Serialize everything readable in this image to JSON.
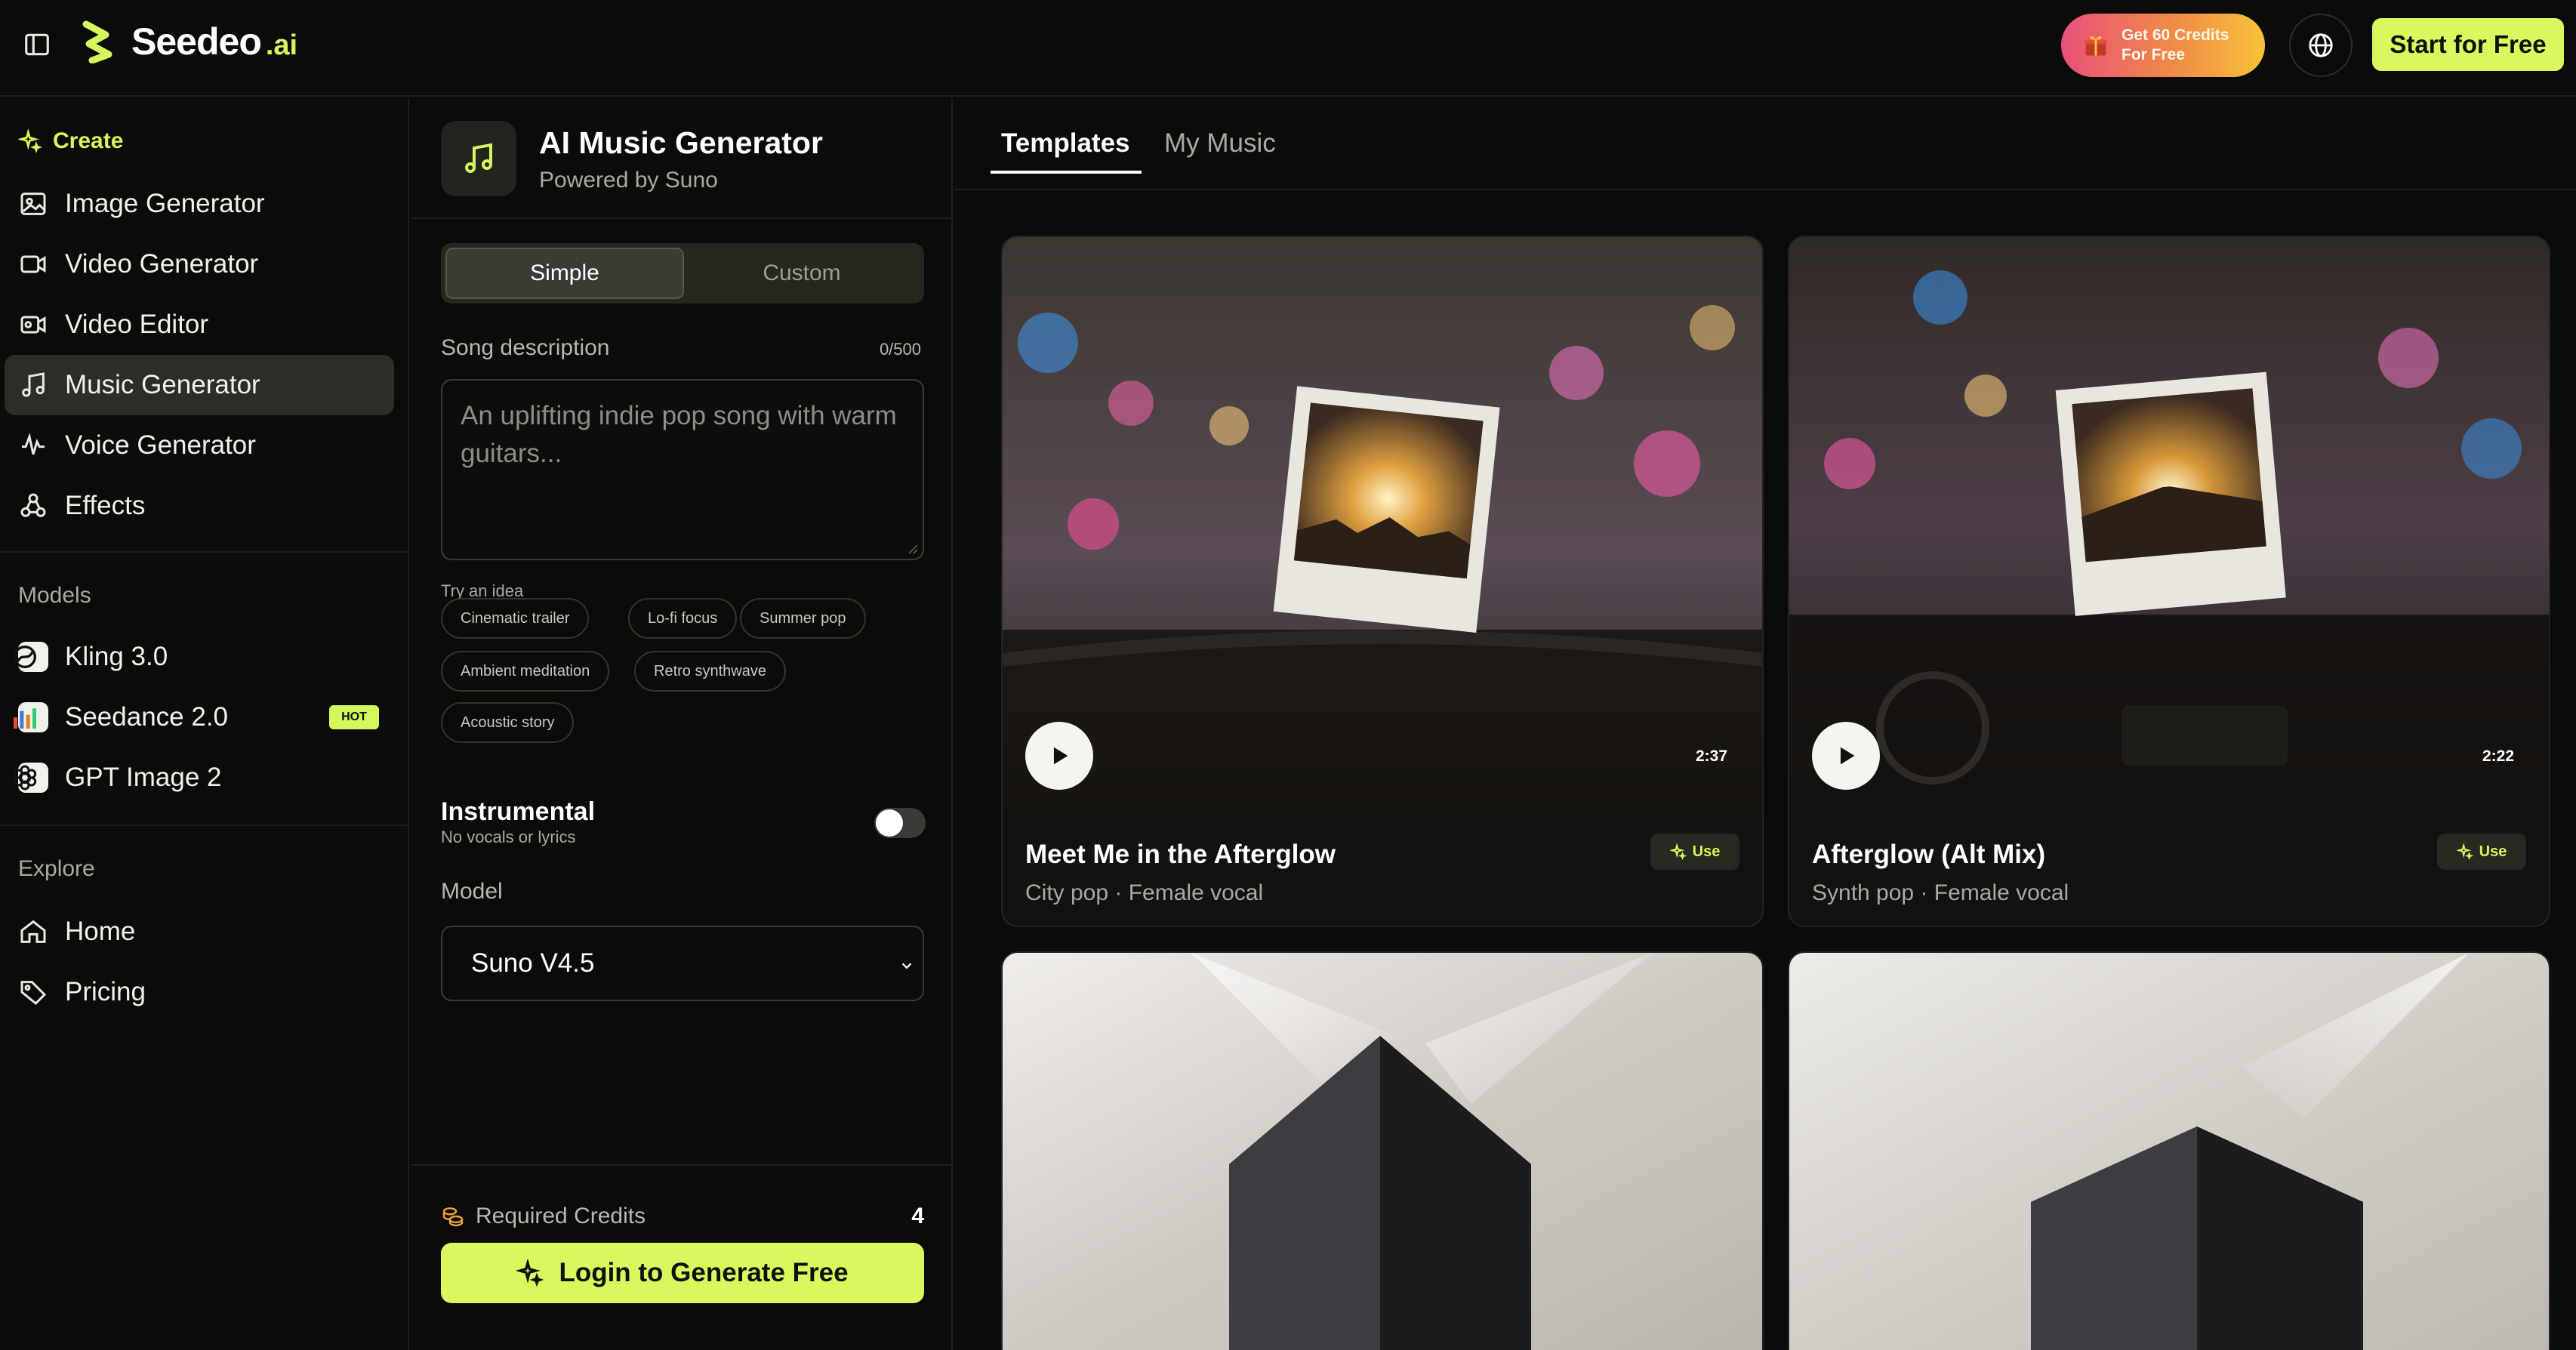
{
  "brand": {
    "name": "Seedeo",
    "tld": ".ai",
    "accent": "#d9f85e"
  },
  "topbar": {
    "credits_line1": "Get 60 Credits",
    "credits_line2": "For Free",
    "start_label": "Start for Free"
  },
  "sidebar": {
    "create_label": "Create",
    "create_items": [
      {
        "label": "Image Generator",
        "icon": "image-icon"
      },
      {
        "label": "Video Generator",
        "icon": "video-icon"
      },
      {
        "label": "Video Editor",
        "icon": "video-editor-icon"
      },
      {
        "label": "Music Generator",
        "icon": "music-note-icon",
        "active": true
      },
      {
        "label": "Voice Generator",
        "icon": "waveform-icon"
      },
      {
        "label": "Effects",
        "icon": "effects-icon"
      }
    ],
    "models_label": "Models",
    "models": [
      {
        "label": "Kling 3.0",
        "icon": "kling-logo-icon"
      },
      {
        "label": "Seedance 2.0",
        "icon": "seedance-logo-icon",
        "badge": "HOT"
      },
      {
        "label": "GPT Image 2",
        "icon": "openai-logo-icon"
      }
    ],
    "explore_label": "Explore",
    "explore": [
      {
        "label": "Home",
        "icon": "home-icon"
      },
      {
        "label": "Pricing",
        "icon": "tag-icon"
      }
    ]
  },
  "form": {
    "title": "AI Music Generator",
    "subtitle": "Powered by Suno",
    "mode_simple": "Simple",
    "mode_custom": "Custom",
    "desc_label": "Song description",
    "desc_counter": "0/500",
    "desc_placeholder": "An uplifting indie pop song with warm guitars...",
    "try_label": "Try an idea",
    "ideas": [
      "Cinematic trailer",
      "Lo-fi focus",
      "Summer pop",
      "Ambient meditation",
      "Retro synthwave",
      "Acoustic story"
    ],
    "instrumental_label": "Instrumental",
    "instrumental_sub": "No vocals or lyrics",
    "instrumental_on": false,
    "model_label": "Model",
    "model_value": "Suno V4.5",
    "required_credits_label": "Required Credits",
    "required_credits": "4",
    "login_label": "Login to Generate Free"
  },
  "content": {
    "tabs": [
      "Templates",
      "My Music"
    ],
    "active_tab": "Templates",
    "cards": [
      {
        "title": "Meet Me in the Afterglow",
        "subtitle": "City pop · Female vocal",
        "duration": "2:37",
        "use": "Use"
      },
      {
        "title": "Afterglow (Alt Mix)",
        "subtitle": "Synth pop · Female vocal",
        "duration": "2:22",
        "use": "Use"
      },
      {
        "title": "",
        "subtitle": "",
        "duration": "",
        "use": ""
      },
      {
        "title": "",
        "subtitle": "",
        "duration": "",
        "use": ""
      }
    ]
  }
}
